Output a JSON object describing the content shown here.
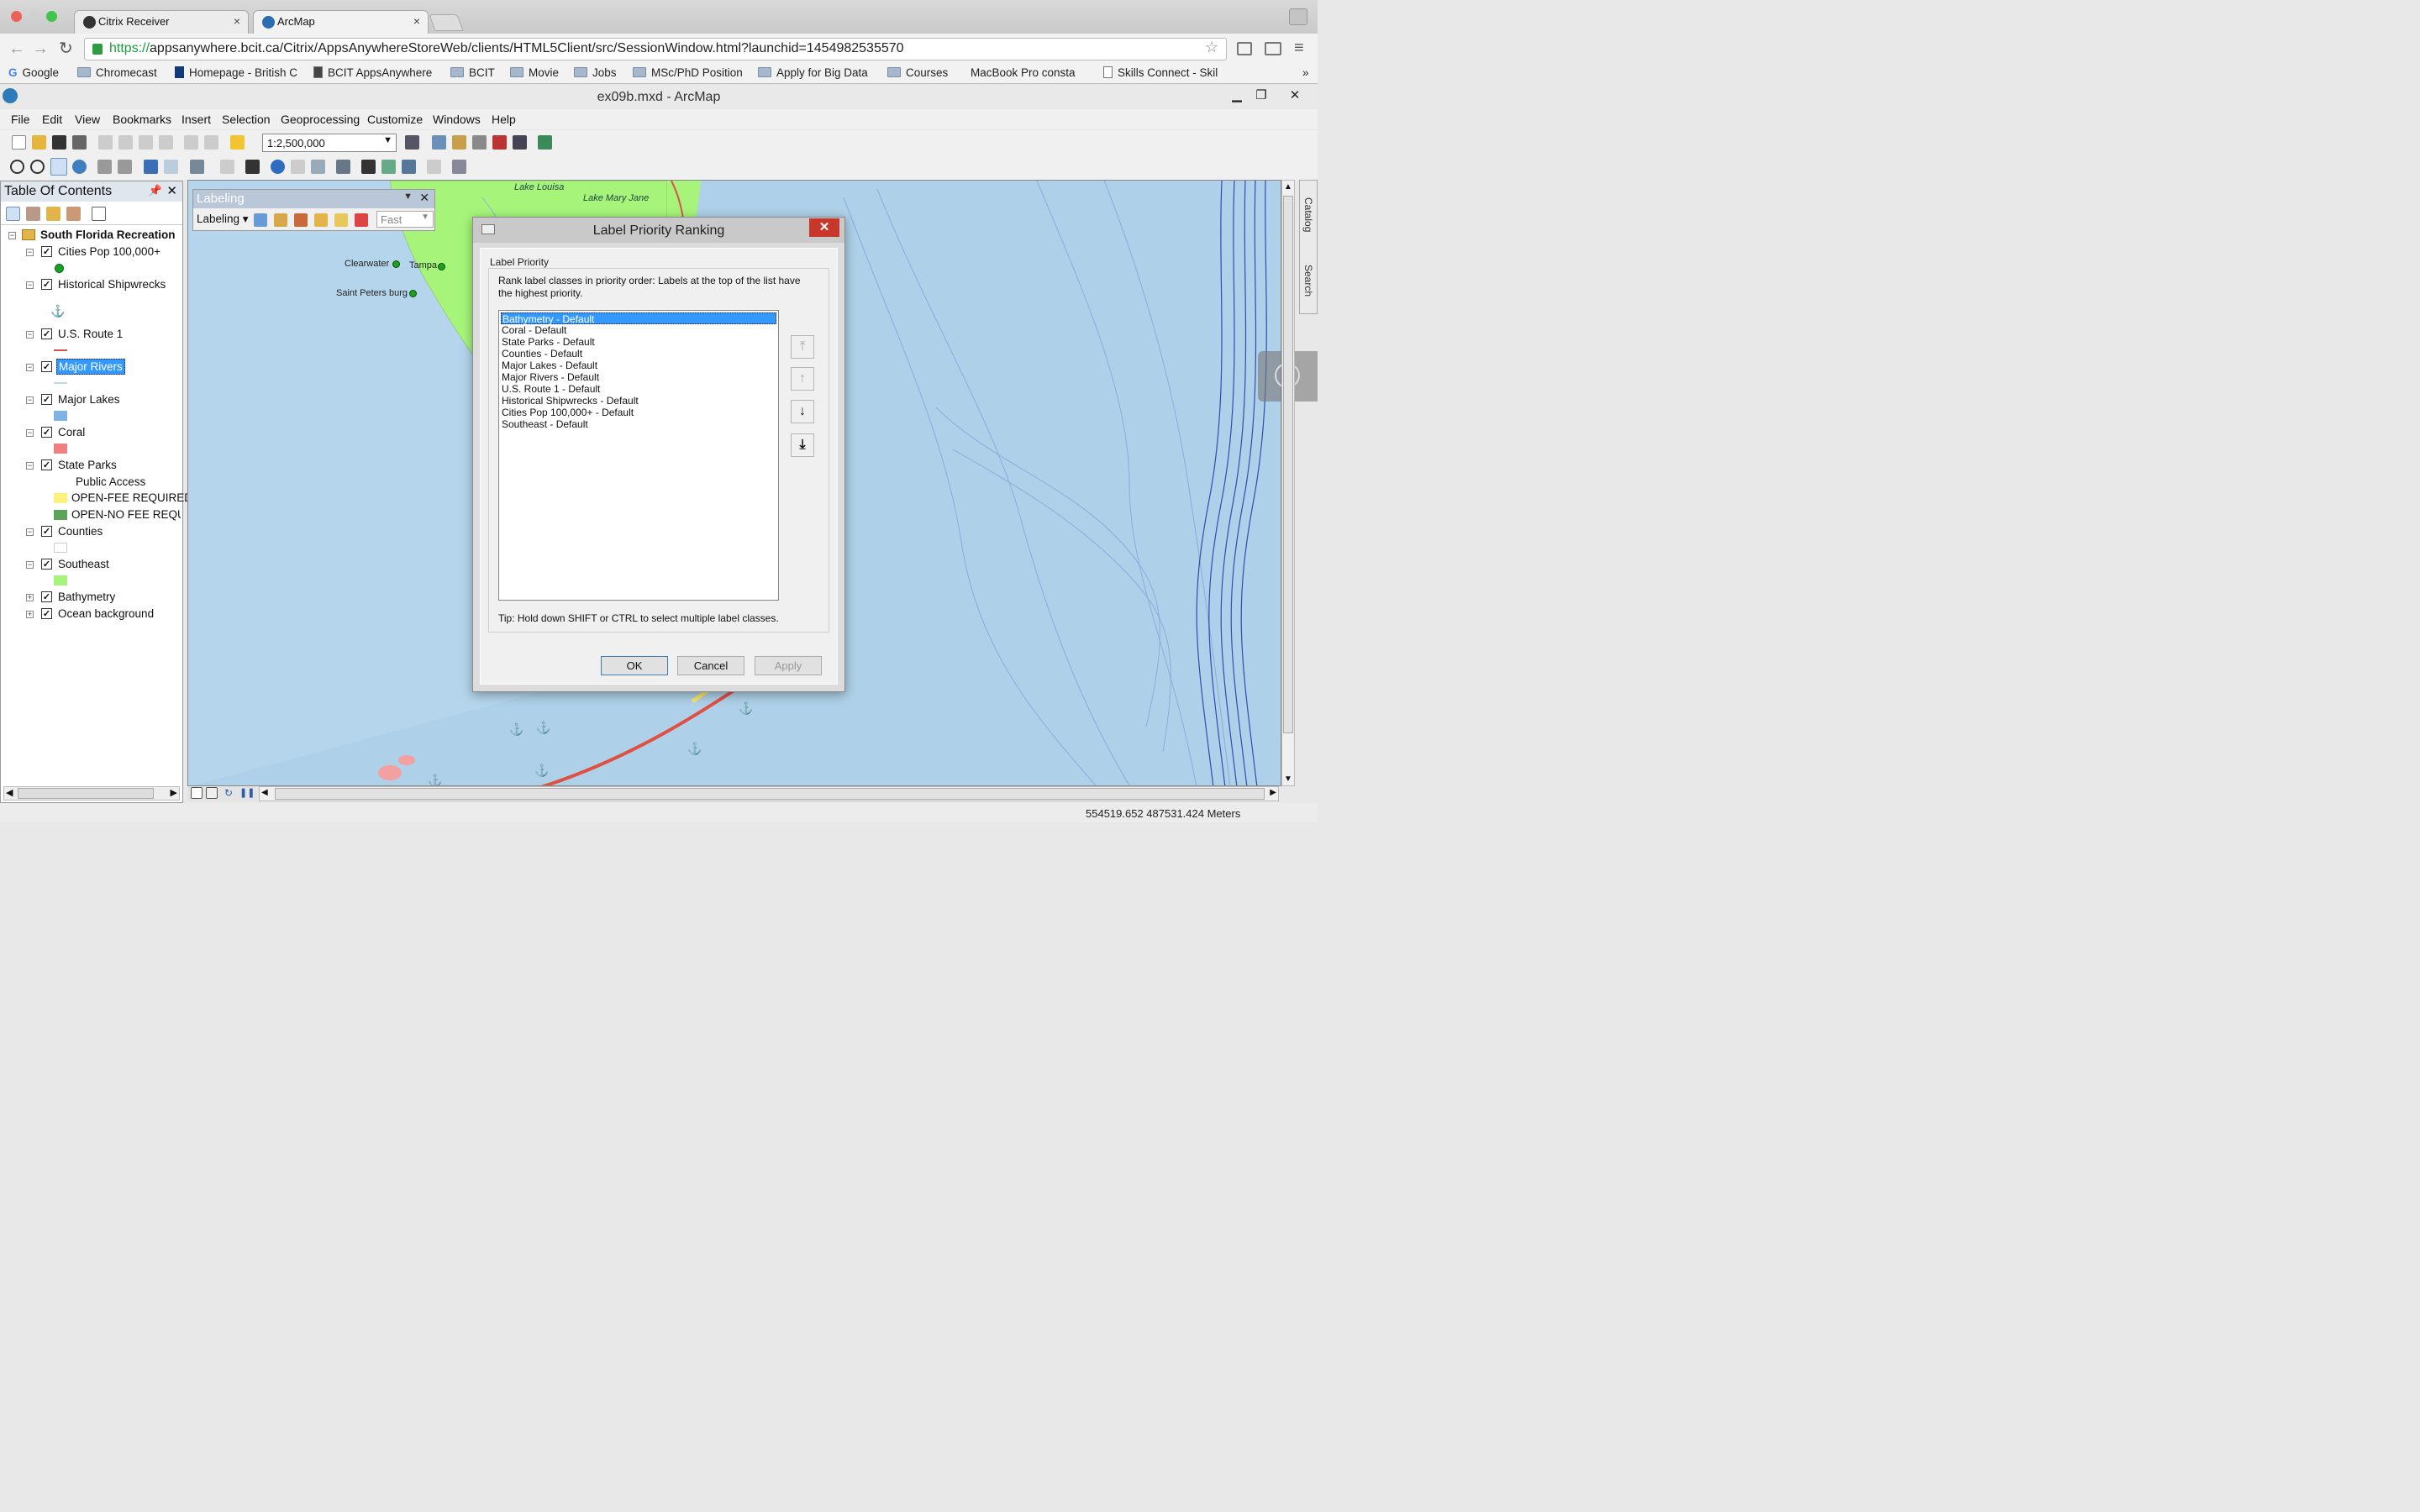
{
  "browser": {
    "tabs": [
      {
        "label": "Citrix Receiver"
      },
      {
        "label": "ArcMap"
      }
    ],
    "url_scheme": "https://",
    "url_rest": "appsanywhere.bcit.ca/Citrix/AppsAnywhereStoreWeb/clients/HTML5Client/src/SessionWindow.html?launchid=1454982535570",
    "bookmarks": [
      "Google",
      "Chromecast",
      "Homepage - British C",
      "BCIT AppsAnywhere",
      "BCIT",
      "Movie",
      "Jobs",
      "MSc/PhD Position",
      "Apply for Big Data",
      "Courses",
      "MacBook Pro consta",
      "Skills Connect - Skil"
    ],
    "bookmarks_overflow": "»"
  },
  "arcmap": {
    "title": "ex09b.mxd - ArcMap",
    "menu": [
      "File",
      "Edit",
      "View",
      "Bookmarks",
      "Insert",
      "Selection",
      "Geoprocessing",
      "Customize",
      "Windows",
      "Help"
    ],
    "scale": "1:2,500,000",
    "status_coords": "554519.652  487531.424 Meters"
  },
  "toc": {
    "title": "Table Of Contents",
    "group": "South Florida Recreation",
    "layers": [
      {
        "name": "Cities Pop 100,000+",
        "checked": true
      },
      {
        "name": "Historical Shipwrecks",
        "checked": true
      },
      {
        "name": "U.S. Route 1",
        "checked": true
      },
      {
        "name": "Major Rivers",
        "checked": true,
        "selected": true
      },
      {
        "name": "Major Lakes",
        "checked": true
      },
      {
        "name": "Coral",
        "checked": true
      },
      {
        "name": "State Parks",
        "checked": true
      },
      {
        "name": "Counties",
        "checked": true
      },
      {
        "name": "Southeast",
        "checked": true
      },
      {
        "name": "Bathymetry",
        "checked": true
      },
      {
        "name": "Ocean background",
        "checked": true
      }
    ],
    "state_parks_field": "Public Access",
    "state_parks_classes": [
      "OPEN-FEE REQUIRED",
      "OPEN-NO FEE REQUIR"
    ],
    "colors": {
      "cities": "#1aa31a",
      "route": "#d9534f",
      "rivers": "#bcd8f0",
      "lakes": "#7fb3e8",
      "coral": "#f08080",
      "fee": "#fff27a",
      "nofee": "#5aa55a",
      "counties": "#ffffff",
      "southeast": "#a6f57a"
    }
  },
  "labeling_toolbar": {
    "title": "Labeling",
    "dropdown": "Labeling",
    "mode": "Fast"
  },
  "map": {
    "labels": {
      "lake_louisa": "Lake Louisa",
      "lake_mary_jane": "Lake Mary Jane",
      "clearwater": "Clearwater",
      "tampa": "Tampa",
      "st_pete": "Saint Peters burg"
    }
  },
  "dialog": {
    "title": "Label Priority Ranking",
    "group_label": "Label Priority",
    "instructions": "Rank label classes in priority order: Labels at the top of the list have the highest priority.",
    "items": [
      "Bathymetry - Default",
      "Coral - Default",
      "State Parks - Default",
      "Counties - Default",
      "Major Lakes - Default",
      "Major Rivers - Default",
      "U.S. Route 1 - Default",
      "Historical Shipwrecks - Default",
      "Cities Pop 100,000+ - Default",
      "Southeast - Default"
    ],
    "selected_index": 0,
    "tip": "Tip: Hold down SHIFT or CTRL to select multiple label classes.",
    "ok": "OK",
    "cancel": "Cancel",
    "apply": "Apply"
  },
  "side_dock": {
    "catalog": "Catalog",
    "search": "Search"
  }
}
